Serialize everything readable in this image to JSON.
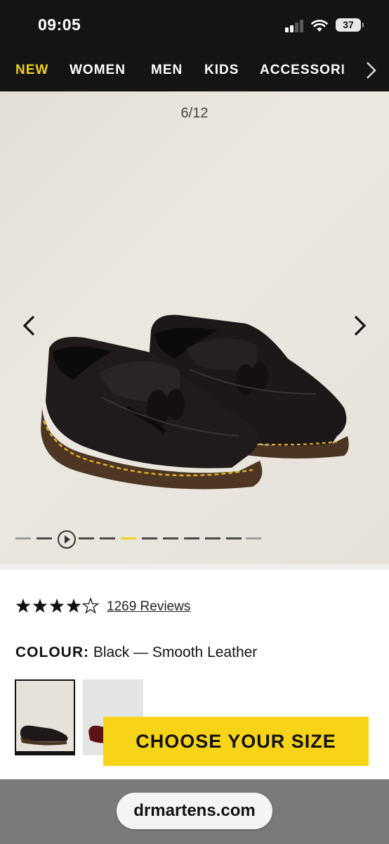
{
  "status_bar": {
    "time": "09:05",
    "battery": "37"
  },
  "nav": {
    "items": [
      {
        "label": "NEW",
        "active": true
      },
      {
        "label": "WOMEN",
        "active": false
      },
      {
        "label": "MEN",
        "active": false
      },
      {
        "label": "KIDS",
        "active": false
      },
      {
        "label": "ACCESSORI",
        "active": false
      }
    ],
    "more_icon": "chevron-right-icon"
  },
  "gallery": {
    "counter": "6/12",
    "current_index": 6,
    "total": 12,
    "prev_icon": "chevron-left-icon",
    "next_icon": "chevron-right-icon",
    "product_image": "black-leather-tassel-loafers",
    "indicator_active_color": "#f3d01a"
  },
  "product": {
    "rating_stars": 4,
    "rating_max": 5,
    "reviews_label": "1269 Reviews",
    "colour_label": "COLOUR:",
    "colour_value": "Black — Smooth Leather",
    "swatches": [
      {
        "name": "black-smooth-leather",
        "selected": true
      },
      {
        "name": "oxblood-smooth-leather",
        "selected": false
      }
    ],
    "cta_label": "CHOOSE YOUR SIZE",
    "cta_color": "#f7d418"
  },
  "browser": {
    "url": "drmartens.com"
  }
}
